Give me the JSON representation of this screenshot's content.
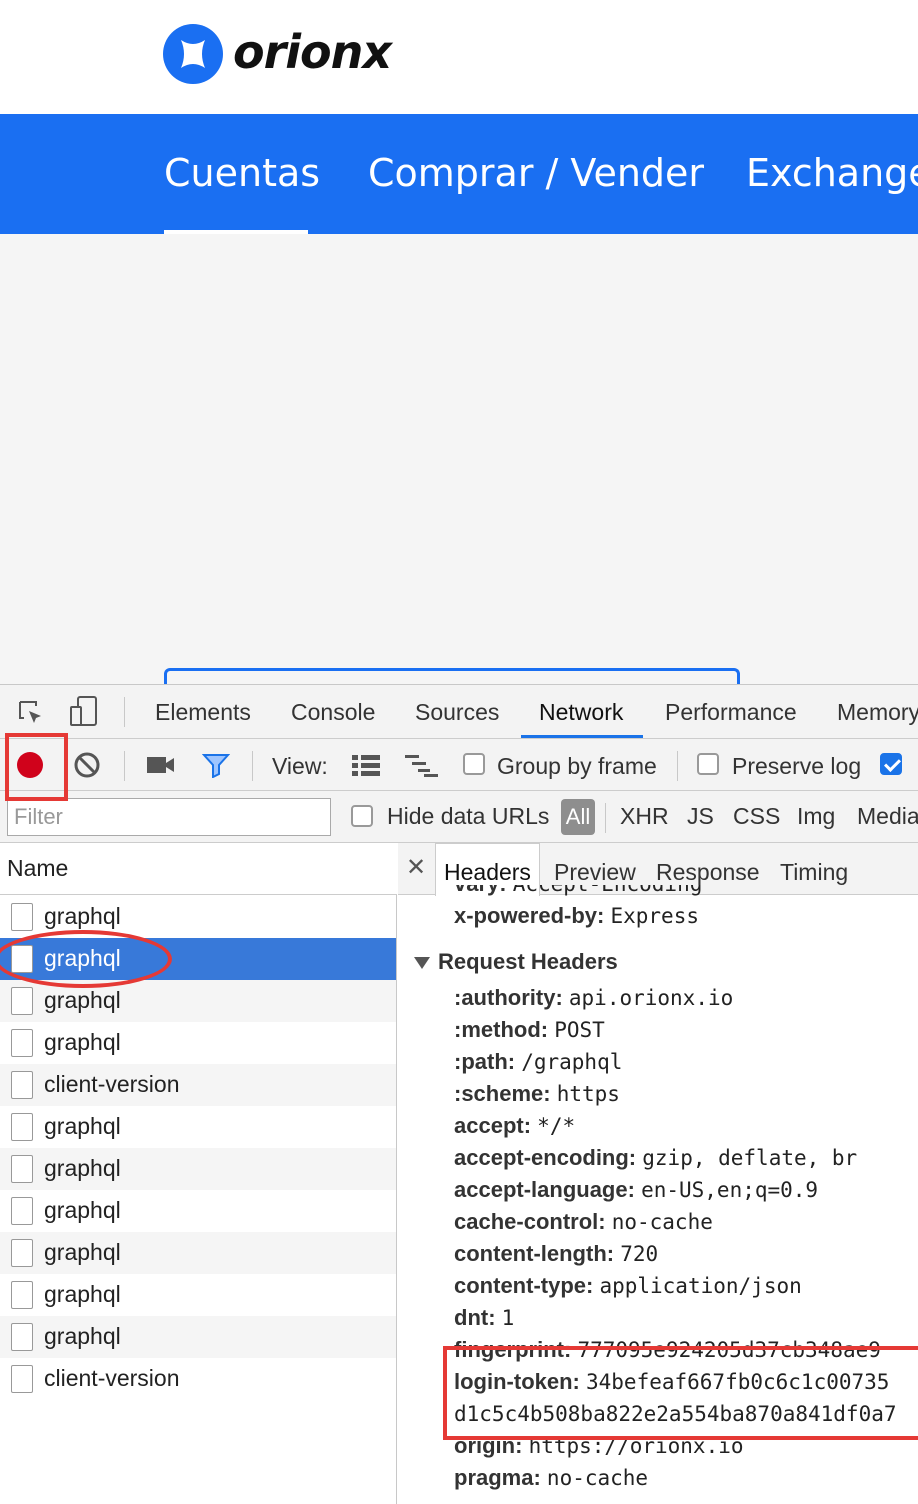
{
  "site": {
    "brand": "orionx",
    "nav": [
      "Cuentas",
      "Comprar / Vender",
      "Exchange"
    ],
    "brand_color": "#1a6ff2"
  },
  "devtools": {
    "tabs": [
      "Elements",
      "Console",
      "Sources",
      "Network",
      "Performance",
      "Memory"
    ],
    "active_tab": "Network",
    "toolbar": {
      "view_label": "View:",
      "group_by_frame": "Group by frame",
      "preserve_log": "Preserve log",
      "third_checkbox_checked": true
    },
    "filterbar": {
      "filter_placeholder": "Filter",
      "hide_data_urls": "Hide data URLs",
      "types": [
        "All",
        "XHR",
        "JS",
        "CSS",
        "Img",
        "Media"
      ]
    },
    "name_header": "Name",
    "requests": [
      "graphql",
      "graphql",
      "graphql",
      "graphql",
      "client-version",
      "graphql",
      "graphql",
      "graphql",
      "graphql",
      "graphql",
      "graphql",
      "client-version"
    ],
    "selected_request_index": 1,
    "detail_tabs": [
      "Headers",
      "Preview",
      "Response",
      "Timing"
    ],
    "response_headers_tail": [
      {
        "key": "vary:",
        "value": "Accept-Encoding"
      },
      {
        "key": "x-powered-by:",
        "value": "Express"
      }
    ],
    "request_headers_title": "Request Headers",
    "request_headers": [
      {
        "key": ":authority:",
        "value": "api.orionx.io"
      },
      {
        "key": ":method:",
        "value": "POST"
      },
      {
        "key": ":path:",
        "value": "/graphql"
      },
      {
        "key": ":scheme:",
        "value": "https"
      },
      {
        "key": "accept:",
        "value": "*/*"
      },
      {
        "key": "accept-encoding:",
        "value": "gzip, deflate, br"
      },
      {
        "key": "accept-language:",
        "value": "en-US,en;q=0.9"
      },
      {
        "key": "cache-control:",
        "value": "no-cache"
      },
      {
        "key": "content-length:",
        "value": "720"
      },
      {
        "key": "content-type:",
        "value": "application/json"
      },
      {
        "key": "dnt:",
        "value": "1"
      },
      {
        "key": "fingerprint:",
        "value": "777095e924205d37cb348ae9"
      },
      {
        "key": "login-token:",
        "value": "34befeaf667fb0c6c1c00735"
      },
      {
        "key": "",
        "value": "d1c5c4b508ba822e2a554ba870a841df0a7"
      },
      {
        "key": "origin:",
        "value": "https://orionx.io"
      },
      {
        "key": "pragma:",
        "value": "no-cache"
      }
    ],
    "annotation_color": "#e53935",
    "record_color": "#d0021b"
  }
}
